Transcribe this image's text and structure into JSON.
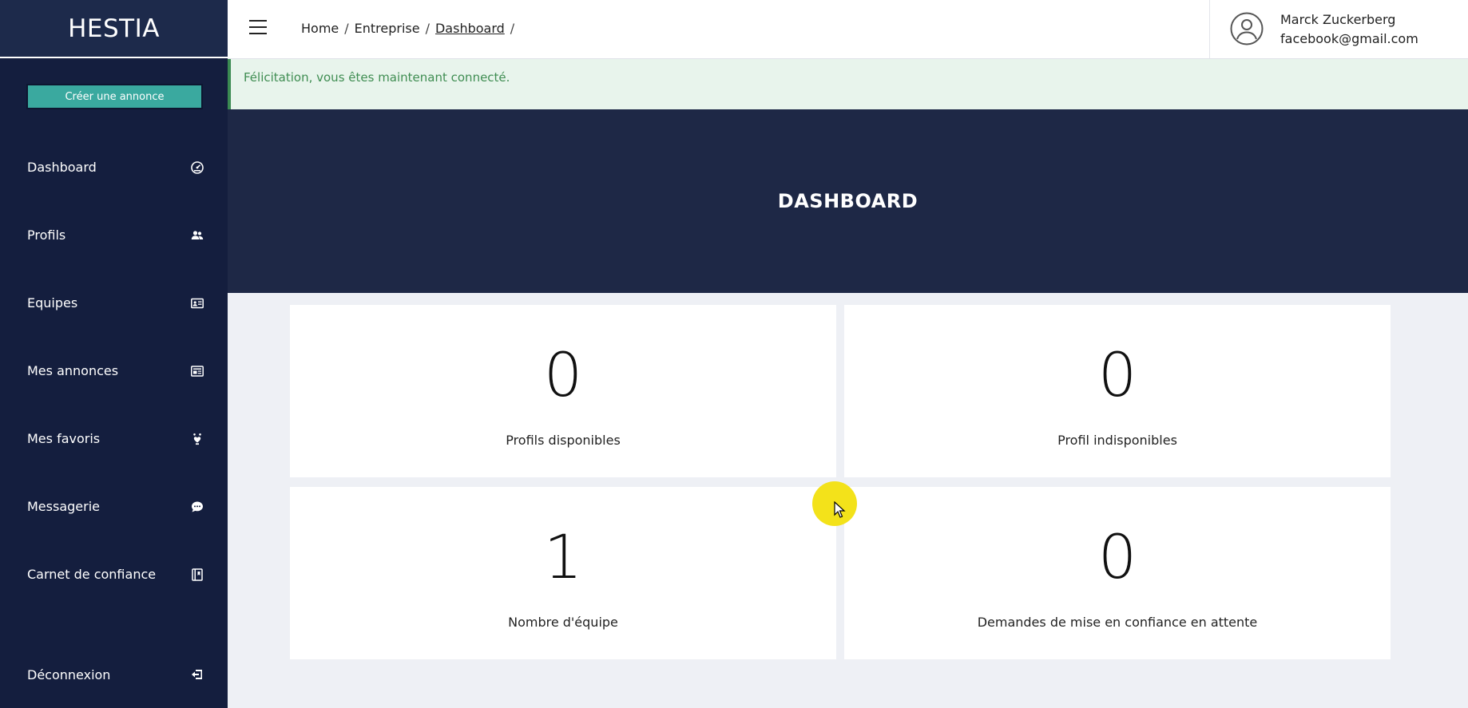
{
  "brand": {
    "logo": "HESTIA"
  },
  "sidebar": {
    "cta_label": "Créer une annonce",
    "items": [
      {
        "label": "Dashboard",
        "icon": "dashboard-icon"
      },
      {
        "label": "Profils",
        "icon": "users-icon"
      },
      {
        "label": "Equipes",
        "icon": "id-card-icon"
      },
      {
        "label": "Mes annonces",
        "icon": "newspaper-icon"
      },
      {
        "label": "Mes favoris",
        "icon": "hand-heart-icon"
      },
      {
        "label": "Messagerie",
        "icon": "chat-icon"
      },
      {
        "label": "Carnet de confiance",
        "icon": "book-icon"
      }
    ],
    "logout": {
      "label": "Déconnexion",
      "icon": "logout-icon"
    }
  },
  "header": {
    "breadcrumb": [
      "Home",
      "Entreprise",
      "Dashboard"
    ],
    "breadcrumb_sep": "/",
    "user": {
      "name": "Marck Zuckerberg",
      "email": "facebook@gmail.com"
    }
  },
  "alert": {
    "message": "Félicitation, vous êtes maintenant connecté."
  },
  "banner": {
    "title": "DASHBOARD"
  },
  "stats": [
    {
      "value": "0",
      "label": "Profils disponibles"
    },
    {
      "value": "0",
      "label": "Profil indisponibles"
    },
    {
      "value": "1",
      "label": "Nombre d'équipe"
    },
    {
      "value": "0",
      "label": "Demandes de mise en confiance en attente"
    }
  ],
  "colors": {
    "sidebar_bg": "#141e3e",
    "banner_bg": "#1e2846",
    "accent": "#3aa99f",
    "alert_bg": "#e8f4ec",
    "alert_text": "#3f8d52"
  }
}
